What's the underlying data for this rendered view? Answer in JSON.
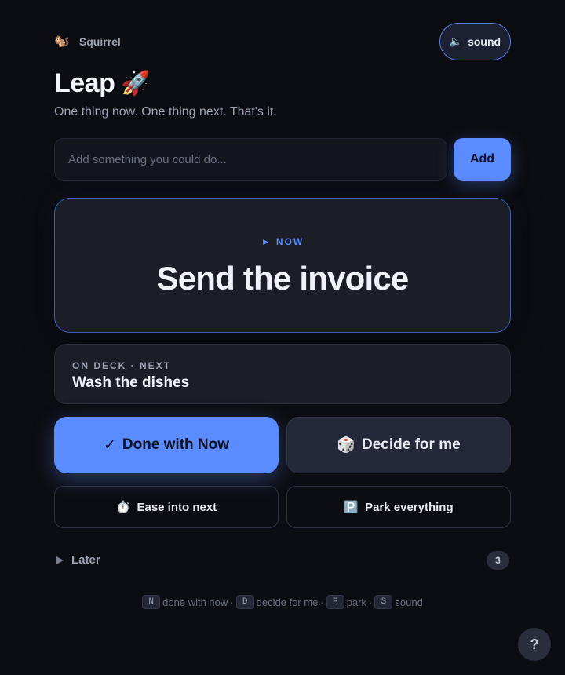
{
  "brand": {
    "icon": "🐿️",
    "name": "Squirrel"
  },
  "sound_button": {
    "icon": "🔈",
    "label": "sound"
  },
  "title": {
    "text": "Leap",
    "icon": "🚀"
  },
  "tagline": "One thing now. One thing next. That's it.",
  "add": {
    "placeholder": "Add something you could do...",
    "value": "",
    "button_label": "Add"
  },
  "now": {
    "label": "► NOW",
    "task": "Send the invoice"
  },
  "next": {
    "label": "ON DECK · NEXT",
    "task": "Wash the dishes"
  },
  "actions": {
    "done": {
      "icon": "✓",
      "label": "Done with Now"
    },
    "decide": {
      "icon": "🎲",
      "label": "Decide for me"
    },
    "ease": {
      "icon": "⏱️",
      "label": "Ease into next"
    },
    "park": {
      "icon": "🅿️",
      "label": "Park everything"
    }
  },
  "later": {
    "label": "Later",
    "count": "3"
  },
  "shortcuts": [
    {
      "key": "N",
      "label": "done with now"
    },
    {
      "key": "D",
      "label": "decide for me"
    },
    {
      "key": "P",
      "label": "park"
    },
    {
      "key": "S",
      "label": "sound"
    }
  ],
  "help": {
    "label": "?"
  },
  "colors": {
    "accent": "#5b8cff",
    "background": "#0c0d12",
    "card": "#1b1d27"
  }
}
